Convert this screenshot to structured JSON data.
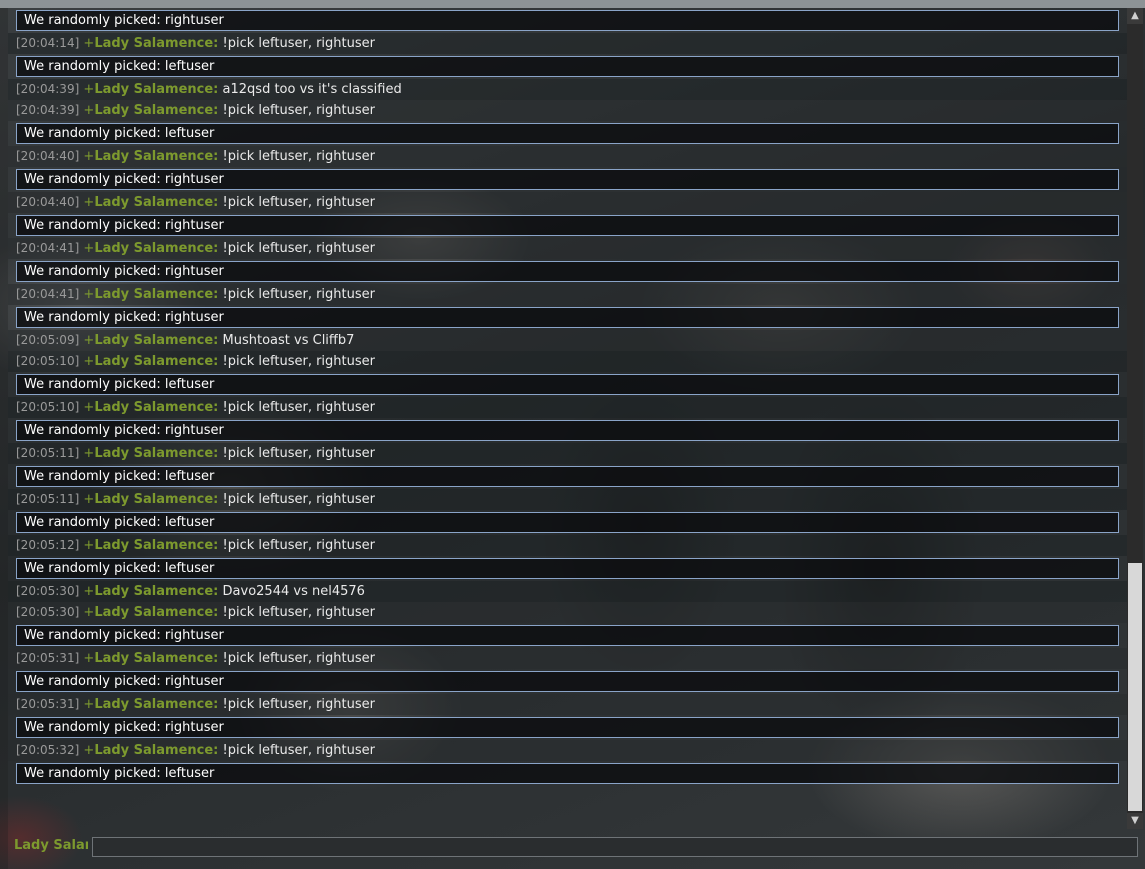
{
  "chat": {
    "lines": [
      {
        "type": "bot",
        "text": "We randomly picked:  rightuser"
      },
      {
        "type": "msg",
        "time": "[20:04:14]",
        "prefix": "+",
        "nick": "Lady Salamence:",
        "text": "!pick leftuser, rightuser"
      },
      {
        "type": "bot",
        "text": "We randomly picked:  leftuser"
      },
      {
        "type": "msg",
        "time": "[20:04:39]",
        "prefix": "+",
        "nick": "Lady Salamence:",
        "text": "a12qsd too vs it's classified"
      },
      {
        "type": "msg",
        "time": "[20:04:39]",
        "prefix": "+",
        "nick": "Lady Salamence:",
        "text": "!pick leftuser, rightuser"
      },
      {
        "type": "bot",
        "text": "We randomly picked:  leftuser"
      },
      {
        "type": "msg",
        "time": "[20:04:40]",
        "prefix": "+",
        "nick": "Lady Salamence:",
        "text": "!pick leftuser, rightuser"
      },
      {
        "type": "bot",
        "text": "We randomly picked:  rightuser"
      },
      {
        "type": "msg",
        "time": "[20:04:40]",
        "prefix": "+",
        "nick": "Lady Salamence:",
        "text": "!pick leftuser, rightuser"
      },
      {
        "type": "bot",
        "text": "We randomly picked:  rightuser"
      },
      {
        "type": "msg",
        "time": "[20:04:41]",
        "prefix": "+",
        "nick": "Lady Salamence:",
        "text": "!pick leftuser, rightuser"
      },
      {
        "type": "bot",
        "text": "We randomly picked:  rightuser"
      },
      {
        "type": "msg",
        "time": "[20:04:41]",
        "prefix": "+",
        "nick": "Lady Salamence:",
        "text": "!pick leftuser, rightuser"
      },
      {
        "type": "bot",
        "text": "We randomly picked:  rightuser"
      },
      {
        "type": "msg",
        "time": "[20:05:09]",
        "prefix": "+",
        "nick": "Lady Salamence:",
        "text": "Mushtoast vs Cliffb7"
      },
      {
        "type": "msg",
        "time": "[20:05:10]",
        "prefix": "+",
        "nick": "Lady Salamence:",
        "text": "!pick leftuser, rightuser"
      },
      {
        "type": "bot",
        "text": "We randomly picked:  leftuser"
      },
      {
        "type": "msg",
        "time": "[20:05:10]",
        "prefix": "+",
        "nick": "Lady Salamence:",
        "text": "!pick leftuser, rightuser"
      },
      {
        "type": "bot",
        "text": "We randomly picked:  rightuser"
      },
      {
        "type": "msg",
        "time": "[20:05:11]",
        "prefix": "+",
        "nick": "Lady Salamence:",
        "text": "!pick leftuser, rightuser"
      },
      {
        "type": "bot",
        "text": "We randomly picked:  leftuser"
      },
      {
        "type": "msg",
        "time": "[20:05:11]",
        "prefix": "+",
        "nick": "Lady Salamence:",
        "text": "!pick leftuser, rightuser"
      },
      {
        "type": "bot",
        "text": "We randomly picked:  leftuser"
      },
      {
        "type": "msg",
        "time": "[20:05:12]",
        "prefix": "+",
        "nick": "Lady Salamence:",
        "text": "!pick leftuser, rightuser"
      },
      {
        "type": "bot",
        "text": "We randomly picked:  leftuser"
      },
      {
        "type": "msg",
        "time": "[20:05:30]",
        "prefix": "+",
        "nick": "Lady Salamence:",
        "text": "Davo2544 vs nel4576"
      },
      {
        "type": "msg",
        "time": "[20:05:30]",
        "prefix": "+",
        "nick": "Lady Salamence:",
        "text": "!pick leftuser, rightuser"
      },
      {
        "type": "bot",
        "text": "We randomly picked:  rightuser"
      },
      {
        "type": "msg",
        "time": "[20:05:31]",
        "prefix": "+",
        "nick": "Lady Salamence:",
        "text": "!pick leftuser, rightuser"
      },
      {
        "type": "bot",
        "text": "We randomly picked:  rightuser"
      },
      {
        "type": "msg",
        "time": "[20:05:31]",
        "prefix": "+",
        "nick": "Lady Salamence:",
        "text": "!pick leftuser, rightuser"
      },
      {
        "type": "bot",
        "text": "We randomly picked:  rightuser"
      },
      {
        "type": "msg",
        "time": "[20:05:32]",
        "prefix": "+",
        "nick": "Lady Salamence:",
        "text": "!pick leftuser, rightuser"
      },
      {
        "type": "bot",
        "text": "We randomly picked:  leftuser"
      }
    ]
  },
  "scrollbar": {
    "up_icon": "scroll-up-arrow-icon",
    "down_icon": "scroll-down-arrow-icon",
    "up_glyph": "▲",
    "down_glyph": "▼"
  },
  "input": {
    "nickname": "Lady Salam",
    "value": ""
  },
  "colors": {
    "nick": "#7d9a2e",
    "timestamp": "#9a9a9a",
    "bot_border": "#8aa4c8"
  }
}
